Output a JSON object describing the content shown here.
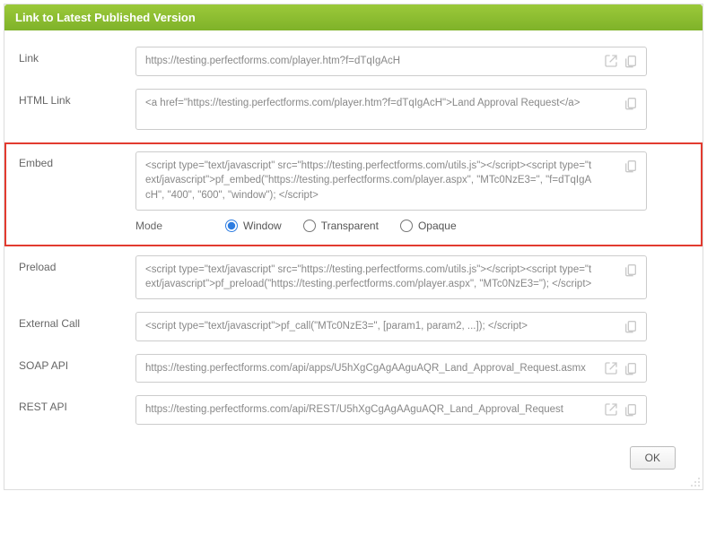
{
  "header": {
    "title": "Link to Latest Published Version"
  },
  "rows": {
    "link": {
      "label": "Link",
      "value": "https://testing.perfectforms.com/player.htm?f=dTqIgAcH"
    },
    "htmlLink": {
      "label": "HTML Link",
      "value": "<a href=\"https://testing.perfectforms.com/player.htm?f=dTqIgAcH\">Land Approval Request</a>"
    },
    "embed": {
      "label": "Embed",
      "value": "<script type=\"text/javascript\" src=\"https://testing.perfectforms.com/utils.js\"></script><script type=\"text/javascript\">pf_embed(\"https://testing.perfectforms.com/player.aspx\", \"MTc0NzE3=\", \"f=dTqIgAcH\", \"400\", \"600\", \"window\"); </script>",
      "modeLabel": "Mode",
      "modes": {
        "window": "Window",
        "transparent": "Transparent",
        "opaque": "Opaque"
      }
    },
    "preload": {
      "label": "Preload",
      "value": "<script type=\"text/javascript\" src=\"https://testing.perfectforms.com/utils.js\"></script><script type=\"text/javascript\">pf_preload(\"https://testing.perfectforms.com/player.aspx\", \"MTc0NzE3=\"); </script>"
    },
    "externalCall": {
      "label": "External Call",
      "value": "<script type=\"text/javascript\">pf_call(\"MTc0NzE3=\", [param1, param2, ...]); </script>"
    },
    "soapApi": {
      "label": "SOAP API",
      "value": "https://testing.perfectforms.com/api/apps/U5hXgCgAgAAguAQR_Land_Approval_Request.asmx"
    },
    "restApi": {
      "label": "REST API",
      "value": "https://testing.perfectforms.com/api/REST/U5hXgCgAgAAguAQR_Land_Approval_Request"
    }
  },
  "footer": {
    "okLabel": "OK"
  }
}
